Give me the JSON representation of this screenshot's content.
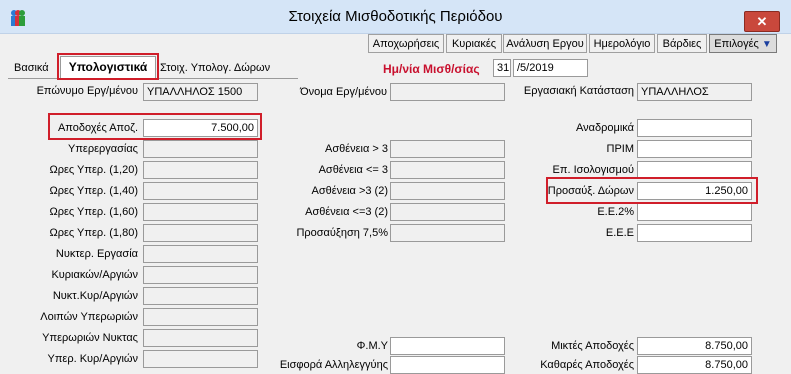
{
  "window": {
    "title": "Στοιχεία Μισθοδοτικής Περιόδου"
  },
  "toolbar": {
    "buttons": [
      "Αποχωρήσεις",
      "Κυριακές",
      "Ανάλυση Εργου",
      "Ημερολόγιο",
      "Βάρδιες",
      "Επιλογές"
    ]
  },
  "tabs": [
    "Βασικά",
    "Υπολογιστικά",
    "Στοιχ. Υπολογ. Δώρων"
  ],
  "period": {
    "label": "Ημ/νία Μισθ/σίας",
    "day": "31",
    "monthyear": "/5/2019"
  },
  "employee": {
    "surname_label": "Επώνυμο Εργ/μένου",
    "surname": "ΥΠΑΛΛΗΛΟΣ 1500",
    "name_label": "Όνομα Εργ/μένου",
    "name": "",
    "status_label": "Εργασιακή Κατάσταση",
    "status": "ΥΠΑΛΛΗΛΟΣ"
  },
  "left_fields": [
    {
      "label": "Αποδοχές Αποζ.",
      "value": "7.500,00"
    },
    {
      "label": "Υπερεργασίας",
      "value": ""
    },
    {
      "label": "Ωρες Υπερ. (1,20)",
      "value": ""
    },
    {
      "label": "Ωρες Υπερ. (1,40)",
      "value": ""
    },
    {
      "label": "Ωρες Υπερ. (1,60)",
      "value": ""
    },
    {
      "label": "Ωρες Υπερ. (1,80)",
      "value": ""
    },
    {
      "label": "Νυκτερ. Εργασία",
      "value": ""
    },
    {
      "label": "Κυριακών/Αργιών",
      "value": ""
    },
    {
      "label": "Νυκτ.Κυρ/Αργιών",
      "value": ""
    },
    {
      "label": "Λοιπών Υπερωριών",
      "value": ""
    },
    {
      "label": "Υπερωριών Νυκτας",
      "value": ""
    },
    {
      "label": "Υπερ. Κυρ/Αργιών",
      "value": ""
    }
  ],
  "middle_fields": [
    {
      "label": "Ασθένεια > 3",
      "value": ""
    },
    {
      "label": "Ασθένεια <= 3",
      "value": ""
    },
    {
      "label": "Ασθένεια >3 (2)",
      "value": ""
    },
    {
      "label": "Ασθένεια <=3 (2)",
      "value": ""
    },
    {
      "label": "Προσαύξηση 7,5%",
      "value": ""
    }
  ],
  "middle_bottom": [
    {
      "label": "Φ.Μ.Υ",
      "value": ""
    },
    {
      "label": "Εισφορά Αλληλεγγύης",
      "value": ""
    }
  ],
  "right_fields": [
    {
      "label": "Αναδρομικά",
      "value": ""
    },
    {
      "label": "ΠΡΙΜ",
      "value": ""
    },
    {
      "label": "Επ. Ισολογισμού",
      "value": ""
    },
    {
      "label": "Προσαύξ. Δώρων",
      "value": "1.250,00"
    },
    {
      "label": "Ε.Ε.2%",
      "value": ""
    },
    {
      "label": "Ε.Ε.Ε",
      "value": ""
    }
  ],
  "right_bottom": [
    {
      "label": "Μικτές Αποδοχές",
      "value": "8.750,00"
    },
    {
      "label": "Καθαρές Αποδοχές",
      "value": "8.750,00"
    }
  ],
  "colors": {
    "highlight": "#d01e2a",
    "period_label": "#c8102e"
  },
  "icons": [
    "app-people-icon",
    "close-icon",
    "dropdown-arrow-icon"
  ]
}
